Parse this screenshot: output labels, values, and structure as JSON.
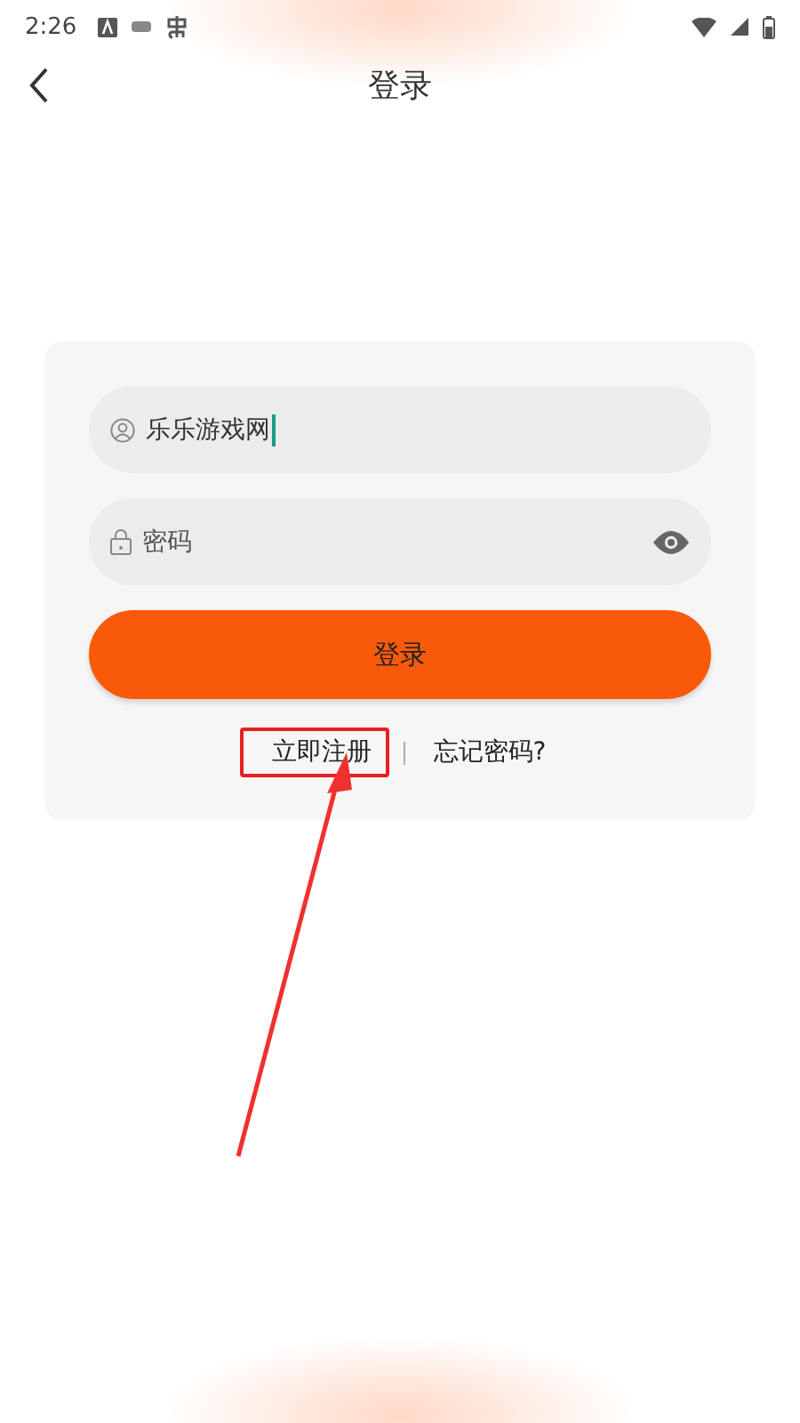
{
  "status_bar": {
    "time": "2:26"
  },
  "header": {
    "title": "登录"
  },
  "form": {
    "username": {
      "value": "乐乐游戏网",
      "focused": true
    },
    "password": {
      "placeholder": "密码"
    },
    "submit": "登录",
    "links": [
      {
        "label": "立即注册",
        "highlighted": true
      },
      {
        "label": "忘记密码?",
        "highlighted": false
      }
    ]
  }
}
